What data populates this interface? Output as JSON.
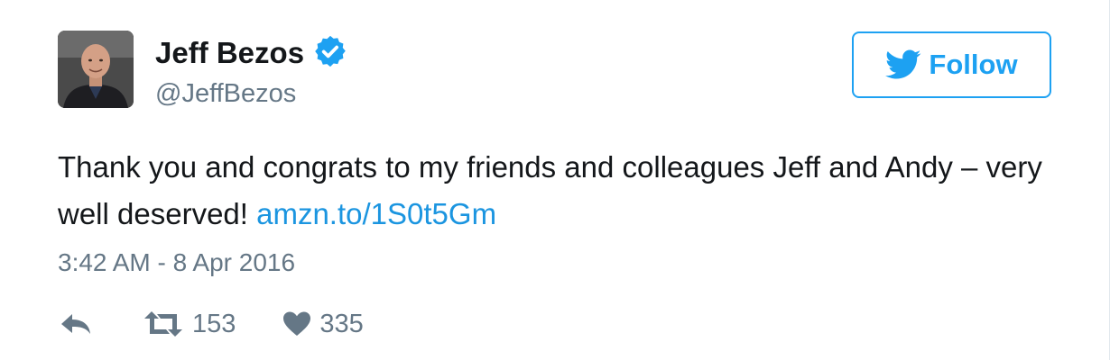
{
  "tweet": {
    "user": {
      "name": "Jeff Bezos",
      "handle": "@JeffBezos",
      "verified": true
    },
    "follow_label": "Follow",
    "text_before_link": "Thank you and congrats to my friends and colleagues Jeff and Andy – very well deserved! ",
    "link_text": "amzn.to/1S0t5Gm",
    "timestamp": "3:42 AM - 8 Apr 2016",
    "retweet_count": "153",
    "like_count": "335"
  },
  "colors": {
    "accent": "#1da1f2",
    "link": "#1b95e0",
    "muted": "#657786",
    "text": "#14171a"
  },
  "icons": {
    "verified": "verified-badge-icon",
    "follow": "twitter-bird-icon",
    "reply": "reply-arrow-icon",
    "retweet": "retweet-icon",
    "like": "heart-icon"
  }
}
